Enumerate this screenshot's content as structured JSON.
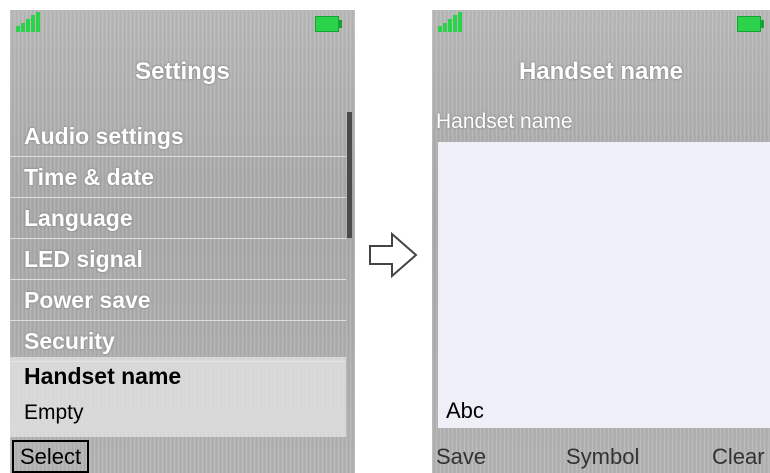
{
  "left_screen": {
    "title": "Settings",
    "menu_items": [
      "Audio settings",
      "Time & date",
      "Language",
      "LED signal",
      "Power save",
      "Security"
    ],
    "selected_item": {
      "label": "Handset name",
      "value": "Empty"
    },
    "softkey": "Select"
  },
  "right_screen": {
    "title": "Handset name",
    "field_label": "Handset name",
    "input_mode": "Abc",
    "softkeys": {
      "left": "Save",
      "middle": "Symbol",
      "right": "Clear"
    }
  },
  "icons": {
    "signal": "signal-strength-icon",
    "battery": "battery-icon",
    "transition": "arrow-right-icon"
  },
  "colors": {
    "battery": "#2bd34a",
    "signal": "#2bd34a"
  }
}
